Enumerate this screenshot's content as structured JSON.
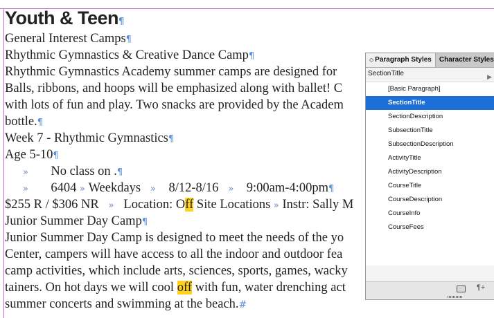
{
  "document": {
    "title": "Youth & Teen",
    "lines": [
      {
        "text": "General Interest Camps"
      },
      {
        "text": "Rhythmic Gymnastics & Creative Dance Camp"
      },
      {
        "text": "Rhythmic Gymnastics Academy summer camps are designed for"
      },
      {
        "text": "Balls, ribbons, and hoops will be emphasized along with ballet!  C"
      },
      {
        "text": "with lots of fun and play.  Two snacks are provided by the Academ"
      },
      {
        "text": "bottle."
      },
      {
        "text": "Week 7 - Rhythmic Gymnastics"
      },
      {
        "text": "Age 5-10"
      }
    ],
    "no_class": "No class on .",
    "course_row": {
      "code": "6404",
      "days": "Weekdays",
      "dates": "8/12-8/16",
      "time": "9:00am-4:00pm"
    },
    "fee_row": {
      "fees": "$255 R / $306 NR",
      "loc_before": "Location: O",
      "loc_hl": "ff",
      "loc_after": " Site Locations",
      "instr": "Instr: Sally M"
    },
    "lines2": [
      {
        "text": "Junior Summer Day Camp"
      },
      {
        "text": "Junior Summer Day Camp is designed to meet the needs of the yo"
      },
      {
        "text": "Center, campers will have access to all the indoor and outdoor fea"
      },
      {
        "text": "camp activities, which include arts, sciences, sports, games, wacky"
      }
    ],
    "hot_line": {
      "before": "tainers. On hot days we will cool ",
      "hl": "off",
      "after": " with fun, water drenching act"
    },
    "last_line": "summer concerts and swimming at the beach."
  },
  "panel": {
    "tabs": [
      "Paragraph Styles",
      "Character Styles"
    ],
    "current_style": "SectionTitle",
    "styles": [
      "[Basic Paragraph]",
      "SectionTitle",
      "SectionDescription",
      "SubsectionTitle",
      "SubsectionDescription",
      "ActivityTitle",
      "ActivityDescription",
      "CourseTitle",
      "CourseDescription",
      "CourseInfo",
      "CourseFees"
    ],
    "selected": "SectionTitle",
    "icons": [
      "folder-icon",
      "new-style-icon"
    ]
  },
  "colors": {
    "selection": "#1c6fd6",
    "highlight": "#ffd21f",
    "hidden_chars": "#5b8fd6",
    "frame": "#c66ad6"
  }
}
